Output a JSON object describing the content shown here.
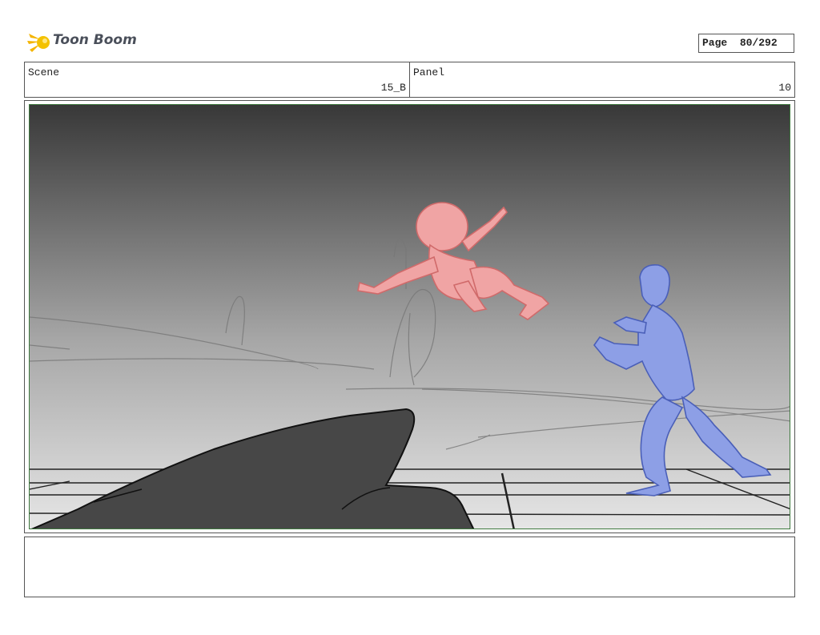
{
  "brand": {
    "name": "Toon Boom"
  },
  "page": {
    "label": "Page",
    "number": "80/292"
  },
  "scene": {
    "label": "Scene",
    "value": "15_B"
  },
  "panel": {
    "label": "Panel",
    "value": "10"
  },
  "notes": {
    "text": ""
  },
  "colors": {
    "frame_border": "#3f7a3f",
    "attacker": "#f2a2a2",
    "defender": "#8ea0e6",
    "rock": "#4a4a4a"
  }
}
